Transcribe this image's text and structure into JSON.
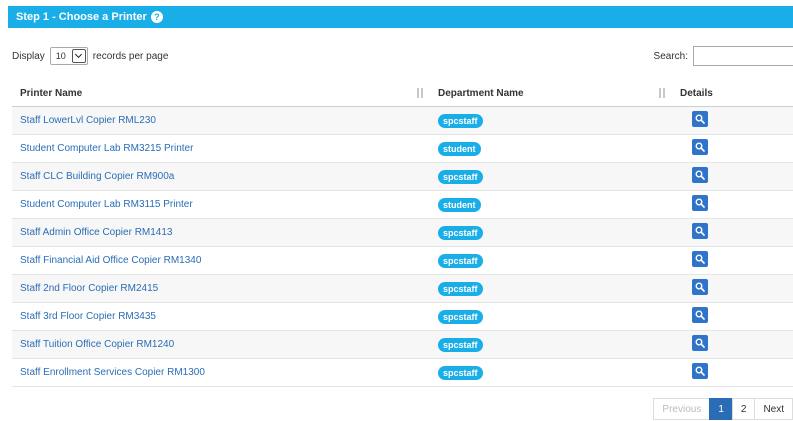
{
  "header": {
    "title": "Step 1 - Choose a Printer",
    "help_icon": "?"
  },
  "controls": {
    "display_label": "Display",
    "page_length": "10",
    "records_label": "records per page",
    "search_label": "Search:",
    "search_value": ""
  },
  "table": {
    "columns": [
      "Printer Name",
      "Department Name",
      "Details"
    ],
    "rows": [
      {
        "printer": "Staff LowerLvl Copier RML230",
        "department": "spcstaff"
      },
      {
        "printer": "Student Computer Lab RM3215 Printer",
        "department": "student"
      },
      {
        "printer": "Staff CLC Building Copier RM900a",
        "department": "spcstaff"
      },
      {
        "printer": "Student Computer Lab RM3115 Printer",
        "department": "student"
      },
      {
        "printer": "Staff Admin Office Copier RM1413",
        "department": "spcstaff"
      },
      {
        "printer": "Staff Financial Aid Office Copier RM1340",
        "department": "spcstaff"
      },
      {
        "printer": "Staff 2nd Floor Copier RM2415",
        "department": "spcstaff"
      },
      {
        "printer": "Staff 3rd Floor Copier RM3435",
        "department": "spcstaff"
      },
      {
        "printer": "Staff Tuition Office Copier RM1240",
        "department": "spcstaff"
      },
      {
        "printer": "Staff Enrollment Services Copier RM1300",
        "department": "spcstaff"
      }
    ],
    "details_icon": "search-icon"
  },
  "pagination": {
    "previous": "Previous",
    "pages": [
      "1",
      "2"
    ],
    "active_page": "1",
    "next": "Next"
  },
  "colors": {
    "header_bg": "#1aaee8",
    "badge_bg": "#1aaee8",
    "link": "#2a6db6",
    "details_btn": "#2f74c8"
  }
}
